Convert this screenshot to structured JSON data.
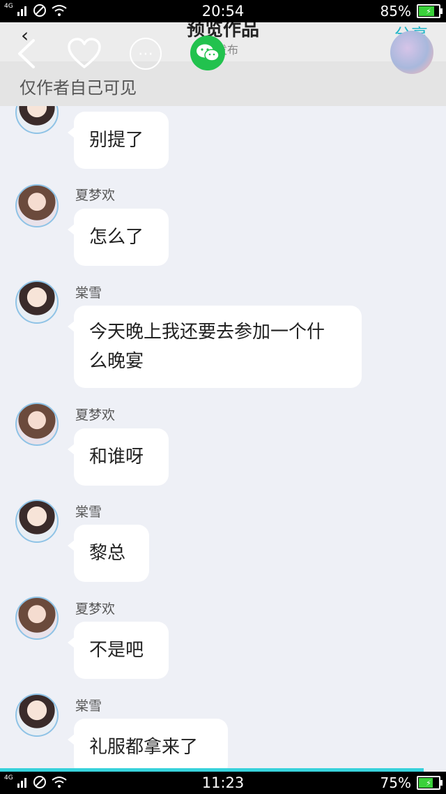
{
  "status_top": {
    "network": "4G",
    "time": "20:54",
    "battery": "85%",
    "battery_level": 0.85
  },
  "status_bottom": {
    "network": "4G",
    "time": "11:23",
    "battery": "75%",
    "battery_level": 0.75
  },
  "header": {
    "title": "预览作品",
    "subtitle": "发布",
    "share_label": "分享",
    "privacy_label": "仅作者自己可见",
    "icons": [
      "chevron-left-icon",
      "heart-icon",
      "more-icon",
      "wechat-icon"
    ]
  },
  "messages": [
    {
      "name": "",
      "text": "别提了"
    },
    {
      "name": "夏梦欢",
      "text": "怎么了"
    },
    {
      "name": "棠雪",
      "text": "今天晚上我还要去参加一个什么晚宴"
    },
    {
      "name": "夏梦欢",
      "text": "和谁呀"
    },
    {
      "name": "棠雪",
      "text": "黎总"
    },
    {
      "name": "夏梦欢",
      "text": "不是吧"
    },
    {
      "name": "棠雪",
      "text": "礼服都拿来了"
    }
  ],
  "reading_progress": 0.95
}
